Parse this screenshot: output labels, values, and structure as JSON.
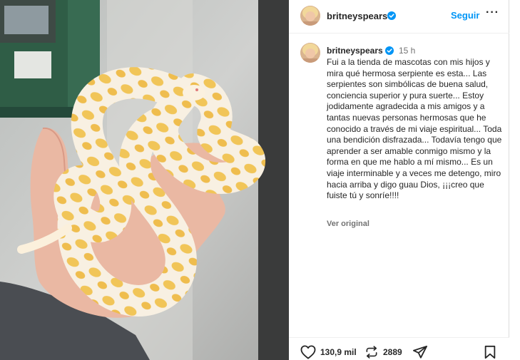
{
  "header": {
    "username": "britneyspears",
    "follow_label": "Seguir",
    "more_label": "···"
  },
  "caption": {
    "username": "britneyspears",
    "time": "15 h",
    "text": "Fui a la tienda de mascotas con mis hijos y mira qué hermosa serpiente es esta... Las serpientes son simbólicas de buena salud, conciencia superior y pura suerte... Estoy jodidamente agradecida a mis amigos y a tantas nuevas personas hermosas que he conocido a través de mi viaje espiritual... Toda una bendición disfrazada... Todavía tengo que aprender a ser amable conmigo mismo y la forma en que me hablo a mí mismo... Es un viaje interminable y a veces me detengo, miro hacia arriba y digo guau Dios, ¡¡¡creo que fuiste tú y sonríe!!!!",
    "see_original_label": "Ver original"
  },
  "actions": {
    "likes": "130,9 mil",
    "reposts": "2889",
    "like_icon": "heart-icon",
    "repost_icon": "repost-icon",
    "share_icon": "send-icon",
    "save_icon": "bookmark-icon"
  },
  "colors": {
    "accent": "#0095f6",
    "verified": "#0095f6",
    "text": "#262626",
    "muted": "#737373"
  }
}
